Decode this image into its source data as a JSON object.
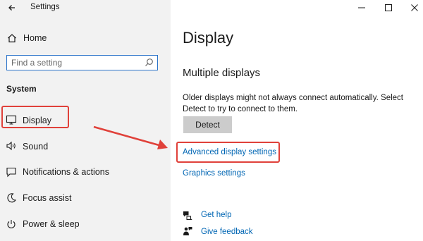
{
  "window": {
    "title": "Settings",
    "controls": [
      "minimize-icon",
      "maximize-icon",
      "close-icon"
    ]
  },
  "sidebar": {
    "home_label": "Home",
    "search": {
      "placeholder": "Find a setting",
      "value": ""
    },
    "section_label": "System",
    "items": [
      {
        "label": "Display",
        "icon": "monitor-icon",
        "selected": true
      },
      {
        "label": "Sound",
        "icon": "speaker-icon"
      },
      {
        "label": "Notifications & actions",
        "icon": "notification-icon"
      },
      {
        "label": "Focus assist",
        "icon": "moon-icon"
      },
      {
        "label": "Power & sleep",
        "icon": "power-icon"
      }
    ]
  },
  "main": {
    "page_title": "Display",
    "section_heading": "Multiple displays",
    "description": "Older displays might not always connect automatically. Select Detect to try to connect to them.",
    "detect_button": "Detect",
    "advanced_link": "Advanced display settings",
    "graphics_link": "Graphics settings",
    "help_link": "Get help",
    "feedback_link": "Give feedback"
  },
  "annotations": {
    "highlight_color": "#e0413a",
    "arrow_color": "#e0413a"
  }
}
